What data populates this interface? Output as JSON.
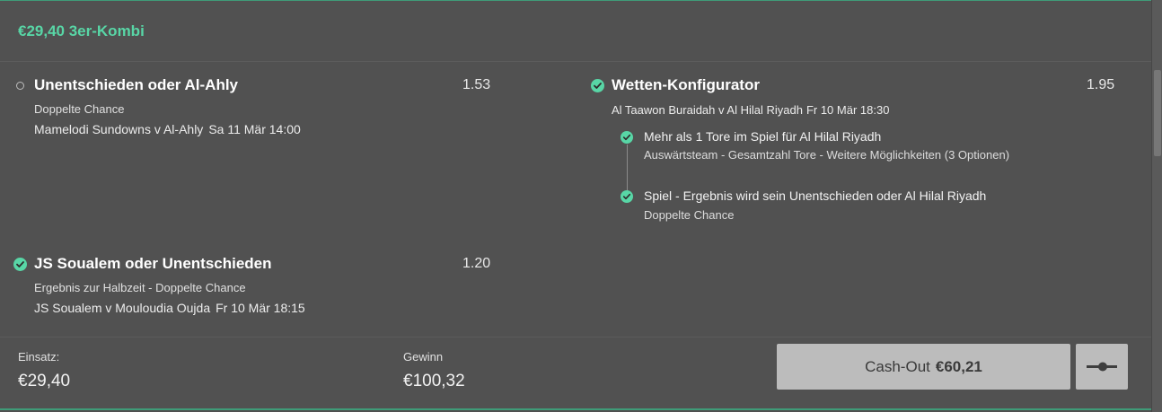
{
  "header": {
    "title": "€29,40 3er-Kombi"
  },
  "selections": [
    {
      "title": "Unentschieden oder Al-Ahly",
      "odds": "1.53",
      "market": "Doppelte Chance",
      "event": "Mamelodi Sundowns v Al-Ahly",
      "time": "Sa 11 Mär 14:00",
      "status": "pending"
    },
    {
      "title": "JS Soualem oder Unentschieden",
      "odds": "1.20",
      "market": "Ergebnis zur Halbzeit - Doppelte Chance",
      "event": "JS Soualem v Mouloudia Oujda",
      "time": "Fr 10 Mär 18:15",
      "status": "won"
    },
    {
      "title": "Wetten-Konfigurator",
      "odds": "1.95",
      "event": "Al Taawon Buraidah v Al Hilal Riyadh",
      "time": "Fr 10 Mär 18:30",
      "status": "won",
      "legs": [
        {
          "title": "Mehr als 1 Tore im Spiel für Al Hilal Riyadh",
          "desc": "Auswärtsteam - Gesamtzahl Tore - Weitere Möglichkeiten (3 Optionen)"
        },
        {
          "title": "Spiel - Ergebnis wird sein Unentschieden oder Al Hilal Riyadh",
          "desc": "Doppelte Chance"
        }
      ]
    }
  ],
  "footer": {
    "stake_label": "Einsatz:",
    "stake_value": "€29,40",
    "win_label": "Gewinn",
    "win_value": "€100,32"
  },
  "cashout": {
    "label": "Cash-Out",
    "amount": "€60,21"
  },
  "colors": {
    "accent": "#58d6a6",
    "background": "#515151",
    "button": "#bcbcbc"
  },
  "icons": {
    "won": "check-circle-icon",
    "pending": "open-circle-icon",
    "toggle": "slider-toggle-icon"
  }
}
